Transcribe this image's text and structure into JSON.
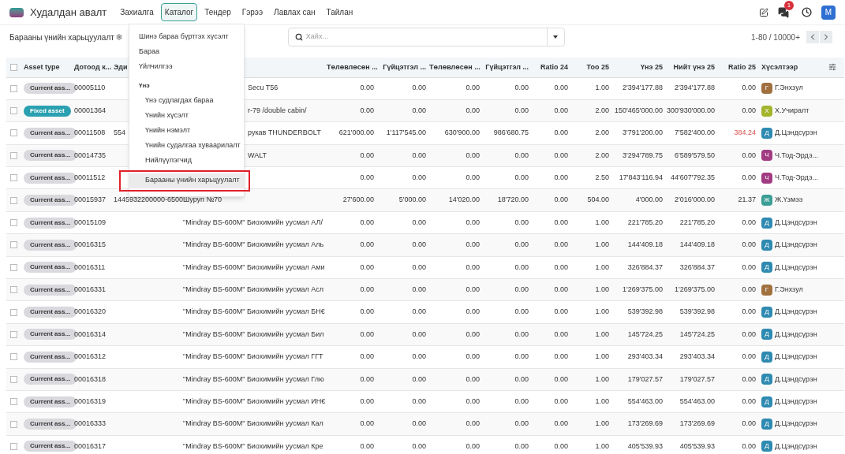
{
  "app": {
    "title": "Худалдан авалт"
  },
  "nav": [
    {
      "label": "Захиалга",
      "selected": false
    },
    {
      "label": "Каталог",
      "selected": true
    },
    {
      "label": "Тендер",
      "selected": false
    },
    {
      "label": "Гэрээ",
      "selected": false
    },
    {
      "label": "Лавлах сан",
      "selected": false
    },
    {
      "label": "Тайлан",
      "selected": false
    }
  ],
  "systray": {
    "message_count": "1",
    "user_initial": "M"
  },
  "page": {
    "title": "Барааны үнийн харьцуулалт",
    "search": {
      "placeholder": "Хайх..."
    },
    "pager": "1-80 / 10000+"
  },
  "menu": {
    "open": true,
    "items": [
      {
        "kind": "item",
        "label": "Шинэ бараа бүртгэх хүсэлт",
        "selected": false
      },
      {
        "kind": "item",
        "label": "Бараа",
        "selected": false
      },
      {
        "kind": "item",
        "label": "Үйлчилгээ",
        "selected": false
      },
      {
        "kind": "header",
        "label": "Үнэ"
      },
      {
        "kind": "subitem",
        "label": "Үнэ судлагдах бараа",
        "selected": false
      },
      {
        "kind": "subitem",
        "label": "Үнийн хүсэлт",
        "selected": false
      },
      {
        "kind": "subitem",
        "label": "Үнийн нэмэлт",
        "selected": false
      },
      {
        "kind": "subitem",
        "label": "Үнийн судалгаа хуваарилалт",
        "selected": false
      },
      {
        "kind": "subitem",
        "label": "Нийлүүлэгчид",
        "selected": false
      },
      {
        "kind": "subitem",
        "label": "Барааны үнийн харьцуулалт",
        "selected": true,
        "outlined": true
      }
    ]
  },
  "table": {
    "all_checked": false,
    "columns": [
      "Asset type",
      "Дотоод к...",
      "Эди",
      "Төлөвлөсөн ...",
      "Гүйцэтгэл ...",
      "Төлөвлөсөн ...",
      "Гүйцэтгэл ...",
      "Ratio 24",
      "Тоо 25",
      "Үнэ 25",
      "Нийт үнэ 25",
      "Ratio 25",
      "Хүсэлтээр"
    ],
    "rows": [
      {
        "checked": false,
        "asset_type": {
          "label": "Current ass...",
          "kind": "current"
        },
        "code": "00005110",
        "barcode": "",
        "name": "Secu T56",
        "values": [
          "0.00",
          "0.00",
          "0.00",
          "0.00",
          "0.00",
          "1.00",
          "2'394'177.88",
          "2'394'177.88"
        ],
        "ratio25": "0.00",
        "alert": false,
        "user": {
          "initial": "Г",
          "name": "Г.Энхзул",
          "color": "#a0703f"
        }
      },
      {
        "checked": false,
        "asset_type": {
          "label": "Fixed asset",
          "kind": "fixed"
        },
        "code": "00001364",
        "barcode": "",
        "name": "r-79 /double cabin/",
        "values": [
          "0.00",
          "0.00",
          "0.00",
          "0.00",
          "0.00",
          "2.00",
          "150'465'000.00",
          "300'930'000.00"
        ],
        "ratio25": "0.00",
        "alert": false,
        "user": {
          "initial": "Х",
          "name": "Х.Учиралт",
          "color": "#a4b42c"
        }
      },
      {
        "checked": false,
        "asset_type": {
          "label": "Current ass...",
          "kind": "current"
        },
        "code": "00011508",
        "barcode": "554",
        "name": "рукав THUNDERBOLT",
        "values": [
          "621'000.00",
          "1'117'545.00",
          "630'900.00",
          "986'680.75",
          "0.00",
          "2.00",
          "3'791'200.00",
          "7'582'400.00"
        ],
        "ratio25": "384.24",
        "alert": true,
        "user": {
          "initial": "Д",
          "name": "Д.Цэндсүрэн",
          "color": "#2e8ab0"
        }
      },
      {
        "checked": false,
        "asset_type": {
          "label": "Current ass...",
          "kind": "current"
        },
        "code": "00014735",
        "barcode": "",
        "name": "WALT",
        "values": [
          "0.00",
          "0.00",
          "0.00",
          "0.00",
          "0.00",
          "2.00",
          "3'294'789.75",
          "6'589'579.50"
        ],
        "ratio25": "0.00",
        "alert": false,
        "user": {
          "initial": "Ч",
          "name": "Ч.Тод-Эрдэ...",
          "color": "#a23c82"
        }
      },
      {
        "checked": false,
        "asset_type": {
          "label": "Current ass...",
          "kind": "current"
        },
        "code": "00011512",
        "barcode": "",
        "name": "",
        "values": [
          "0.00",
          "0.00",
          "0.00",
          "0.00",
          "0.00",
          "2.50",
          "17'843'116.94",
          "44'607'792.35"
        ],
        "ratio25": "0.00",
        "alert": false,
        "user": {
          "initial": "Ч",
          "name": "Ч.Тод-Эрдэ...",
          "color": "#a23c82"
        }
      },
      {
        "checked": false,
        "asset_type": {
          "label": "Current ass...",
          "kind": "current"
        },
        "code": "00015937",
        "barcode": "1445932200000-6500",
        "name": "Шуруп №70",
        "values": [
          "27'600.00",
          "5'000.00",
          "14'020.00",
          "18'720.00",
          "0.00",
          "504.00",
          "4'000.00",
          "2'016'000.00"
        ],
        "ratio25": "21.37",
        "alert": false,
        "user": {
          "initial": "Ж",
          "name": "Ж.Үзмээ",
          "color": "#3a9e95"
        }
      },
      {
        "checked": false,
        "asset_type": {
          "label": "Current ass...",
          "kind": "current"
        },
        "code": "00015109",
        "barcode": "",
        "name": "\"Mindray BS-600M\" Биохимийн уусмал АЛ/",
        "values": [
          "0.00",
          "0.00",
          "0.00",
          "0.00",
          "0.00",
          "1.00",
          "221'785.20",
          "221'785.20"
        ],
        "ratio25": "0.00",
        "alert": false,
        "user": {
          "initial": "Д",
          "name": "Д.Цэндсүрэн",
          "color": "#2e8ab0"
        }
      },
      {
        "checked": false,
        "asset_type": {
          "label": "Current ass...",
          "kind": "current"
        },
        "code": "00016315",
        "barcode": "",
        "name": "\"Mindray BS-600M\" Биохимийн уусмал Аль",
        "values": [
          "0.00",
          "0.00",
          "0.00",
          "0.00",
          "0.00",
          "1.00",
          "144'409.18",
          "144'409.18"
        ],
        "ratio25": "0.00",
        "alert": false,
        "user": {
          "initial": "Д",
          "name": "Д.Цэндсүрэн",
          "color": "#2e8ab0"
        }
      },
      {
        "checked": false,
        "asset_type": {
          "label": "Current ass...",
          "kind": "current"
        },
        "code": "00016311",
        "barcode": "",
        "name": "\"Mindray BS-600M\" Биохимийн уусмал Ами",
        "values": [
          "0.00",
          "0.00",
          "0.00",
          "0.00",
          "0.00",
          "1.00",
          "326'884.37",
          "326'884.37"
        ],
        "ratio25": "0.00",
        "alert": false,
        "user": {
          "initial": "Д",
          "name": "Д.Цэндсүрэн",
          "color": "#2e8ab0"
        }
      },
      {
        "checked": false,
        "asset_type": {
          "label": "Current ass...",
          "kind": "current"
        },
        "code": "00016331",
        "barcode": "",
        "name": "\"Mindray BS-600M\" Биохимийн уусмал Асл",
        "values": [
          "0.00",
          "0.00",
          "0.00",
          "0.00",
          "0.00",
          "1.00",
          "1'269'375.00",
          "1'269'375.00"
        ],
        "ratio25": "0.00",
        "alert": false,
        "user": {
          "initial": "Г",
          "name": "Г.Энхзул",
          "color": "#a0703f"
        }
      },
      {
        "checked": false,
        "asset_type": {
          "label": "Current ass...",
          "kind": "current"
        },
        "code": "00016320",
        "barcode": "",
        "name": "\"Mindray BS-600M\" Биохимийн уусмал БН€",
        "values": [
          "0.00",
          "0.00",
          "0.00",
          "0.00",
          "0.00",
          "1.00",
          "539'392.98",
          "539'392.98"
        ],
        "ratio25": "0.00",
        "alert": false,
        "user": {
          "initial": "Д",
          "name": "Д.Цэндсүрэн",
          "color": "#2e8ab0"
        }
      },
      {
        "checked": false,
        "asset_type": {
          "label": "Current ass...",
          "kind": "current"
        },
        "code": "00016314",
        "barcode": "",
        "name": "\"Mindray BS-600M\" Биохимийн уусмал Бил",
        "values": [
          "0.00",
          "0.00",
          "0.00",
          "0.00",
          "0.00",
          "1.00",
          "145'724.25",
          "145'724.25"
        ],
        "ratio25": "0.00",
        "alert": false,
        "user": {
          "initial": "Д",
          "name": "Д.Цэндсүрэн",
          "color": "#2e8ab0"
        }
      },
      {
        "checked": false,
        "asset_type": {
          "label": "Current ass...",
          "kind": "current"
        },
        "code": "00016312",
        "barcode": "",
        "name": "\"Mindray BS-600M\" Биохимийн уусмал ГГТ",
        "values": [
          "0.00",
          "0.00",
          "0.00",
          "0.00",
          "0.00",
          "1.00",
          "293'403.34",
          "293'403.34"
        ],
        "ratio25": "0.00",
        "alert": false,
        "user": {
          "initial": "Д",
          "name": "Д.Цэндсүрэн",
          "color": "#2e8ab0"
        }
      },
      {
        "checked": false,
        "asset_type": {
          "label": "Current ass...",
          "kind": "current"
        },
        "code": "00016318",
        "barcode": "",
        "name": "\"Mindray BS-600M\" Биохимийн уусмал Глю",
        "values": [
          "0.00",
          "0.00",
          "0.00",
          "0.00",
          "0.00",
          "1.00",
          "179'027.57",
          "179'027.57"
        ],
        "ratio25": "0.00",
        "alert": false,
        "user": {
          "initial": "Д",
          "name": "Д.Цэндсүрэн",
          "color": "#2e8ab0"
        }
      },
      {
        "checked": false,
        "asset_type": {
          "label": "Current ass...",
          "kind": "current"
        },
        "code": "00016319",
        "barcode": "",
        "name": "\"Mindray BS-600M\" Биохимийн уусмал ИН€",
        "values": [
          "0.00",
          "0.00",
          "0.00",
          "0.00",
          "0.00",
          "1.00",
          "554'463.00",
          "554'463.00"
        ],
        "ratio25": "0.00",
        "alert": false,
        "user": {
          "initial": "Д",
          "name": "Д.Цэндсүрэн",
          "color": "#2e8ab0"
        }
      },
      {
        "checked": false,
        "asset_type": {
          "label": "Current ass...",
          "kind": "current"
        },
        "code": "00016333",
        "barcode": "",
        "name": "\"Mindray BS-600M\" Биохимийн уусмал Кал",
        "values": [
          "0.00",
          "0.00",
          "0.00",
          "0.00",
          "0.00",
          "1.00",
          "173'269.69",
          "173'269.69"
        ],
        "ratio25": "0.00",
        "alert": false,
        "user": {
          "initial": "Д",
          "name": "Д.Цэндсүрэн",
          "color": "#2e8ab0"
        }
      },
      {
        "checked": false,
        "asset_type": {
          "label": "Current ass...",
          "kind": "current"
        },
        "code": "00016317",
        "barcode": "",
        "name": "\"Mindray BS-600M\" Биохимийн уусмал Кре",
        "values": [
          "0.00",
          "0.00",
          "0.00",
          "0.00",
          "0.00",
          "1.00",
          "405'539.93",
          "405'539.93"
        ],
        "ratio25": "0.00",
        "alert": false,
        "user": {
          "initial": "Д",
          "name": "Д.Цэндсүрэн",
          "color": "#2e8ab0"
        }
      }
    ]
  }
}
